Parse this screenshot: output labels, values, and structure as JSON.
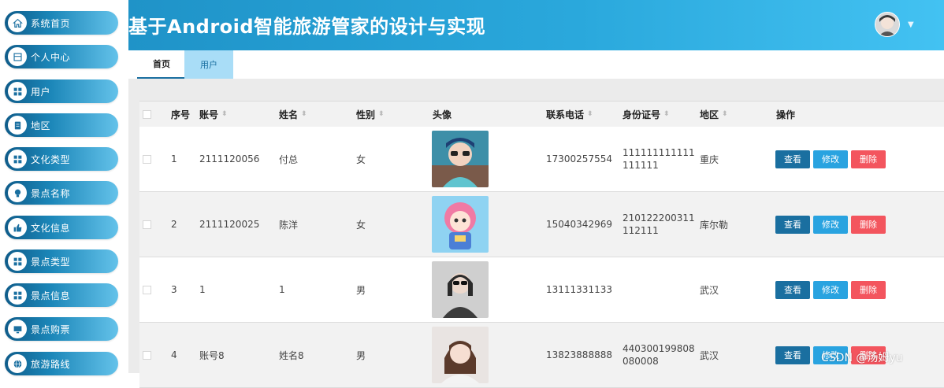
{
  "header": {
    "title": "基于Android智能旅游管家的设计与实现"
  },
  "sidebar": {
    "items": [
      {
        "label": "系统首页",
        "icon": "home-icon"
      },
      {
        "label": "个人中心",
        "icon": "profile-icon"
      },
      {
        "label": "用户",
        "icon": "grid-icon"
      },
      {
        "label": "地区",
        "icon": "document-icon"
      },
      {
        "label": "文化类型",
        "icon": "grid-icon"
      },
      {
        "label": "景点名称",
        "icon": "lightbulb-icon"
      },
      {
        "label": "文化信息",
        "icon": "thumb-icon"
      },
      {
        "label": "景点类型",
        "icon": "grid-icon"
      },
      {
        "label": "景点信息",
        "icon": "grid-icon"
      },
      {
        "label": "景点购票",
        "icon": "monitor-icon"
      },
      {
        "label": "旅游路线",
        "icon": "globe-icon"
      }
    ]
  },
  "tabs": [
    {
      "label": "首页"
    },
    {
      "label": "用户"
    }
  ],
  "table": {
    "columns": {
      "index": "序号",
      "account": "账号",
      "name": "姓名",
      "gender": "性别",
      "avatar": "头像",
      "phone": "联系电话",
      "idcard": "身份证号",
      "region": "地区",
      "actions": "操作"
    },
    "actions": {
      "view": "查看",
      "edit": "修改",
      "delete": "删除"
    },
    "rows": [
      {
        "index": "1",
        "account": "2111120056",
        "name": "付总",
        "gender": "女",
        "phone": "17300257554",
        "idcard": "111111111111111111",
        "region": "重庆"
      },
      {
        "index": "2",
        "account": "2111120025",
        "name": "陈洋",
        "gender": "女",
        "phone": "15040342969",
        "idcard": "210122200311112111",
        "region": "库尔勒"
      },
      {
        "index": "3",
        "account": "1",
        "name": "1",
        "gender": "男",
        "phone": "13111331133",
        "idcard": "",
        "region": "武汉"
      },
      {
        "index": "4",
        "account": "账号8",
        "name": "姓名8",
        "gender": "男",
        "phone": "13823888888",
        "idcard": "440300199808080008",
        "region": "武汉"
      }
    ]
  },
  "watermark": "CSDN @汤姆yu",
  "colors": {
    "primary": "#1a6fa0",
    "edit": "#29a3e0",
    "danger": "#f3555e",
    "header": "#2aa8dc"
  }
}
